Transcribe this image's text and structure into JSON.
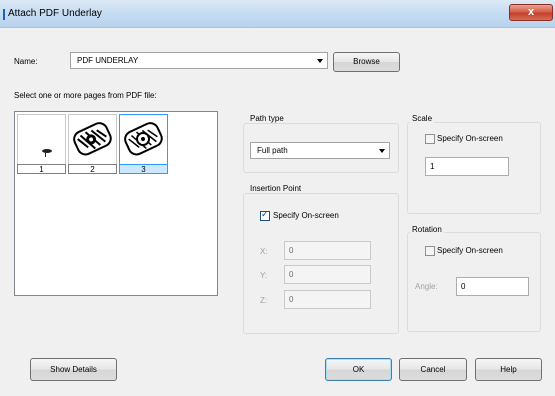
{
  "window": {
    "title": "Attach PDF Underlay",
    "close_glyph": "x"
  },
  "name_row": {
    "label": "Name:",
    "value": "PDF UNDERLAY",
    "browse_label": "Browse"
  },
  "pages": {
    "label": "Select one or more pages from PDF file:",
    "items": [
      {
        "number": "1",
        "selected": false
      },
      {
        "number": "2",
        "selected": false
      },
      {
        "number": "3",
        "selected": true
      }
    ]
  },
  "path_type": {
    "title": "Path type",
    "value": "Full path"
  },
  "insertion": {
    "title": "Insertion Point",
    "specify_label": "Specify On-screen",
    "specify_checked": true,
    "x_label": "X:",
    "x_value": "0",
    "y_label": "Y:",
    "y_value": "0",
    "z_label": "Z:",
    "z_value": "0"
  },
  "scale": {
    "title": "Scale",
    "specify_label": "Specify On-screen",
    "specify_checked": false,
    "value": "1"
  },
  "rotation": {
    "title": "Rotation",
    "specify_label": "Specify On-screen",
    "specify_checked": false,
    "angle_label": "Angle:",
    "angle_value": "0"
  },
  "buttons": {
    "show_details": "Show Details",
    "ok": "OK",
    "cancel": "Cancel",
    "help": "Help"
  },
  "colors": {
    "titlebar": "#c6dcf2",
    "close": "#c4402a",
    "selection": "#cce8ff"
  }
}
